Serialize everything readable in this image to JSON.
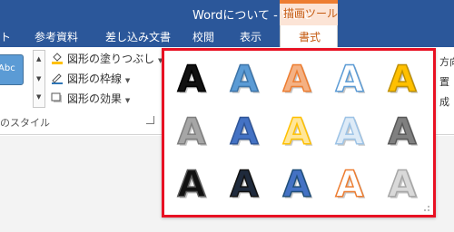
{
  "window": {
    "title": "Wordについて - Word",
    "contextual_tab_group": "描画ツール"
  },
  "tabs": [
    {
      "label": "ト"
    },
    {
      "label": "参考資料"
    },
    {
      "label": "差し込み文書"
    },
    {
      "label": "校閲"
    },
    {
      "label": "表示"
    },
    {
      "label": "書式",
      "active": true
    }
  ],
  "ribbon": {
    "shape_style_thumb": "Abc",
    "commands": {
      "fill": "図形の塗りつぶし",
      "outline": "図形の枠線",
      "effects": "図形の効果"
    },
    "group_label": "のスタイル",
    "right_partial": [
      "方向",
      "置",
      "成"
    ]
  },
  "wordart_gallery": {
    "letter": "A",
    "rows": [
      [
        {
          "style": "fill-black-shadow",
          "fill": "#111111",
          "stroke": "#000000"
        },
        {
          "style": "fill-blue-accent1-shadow",
          "fill": "#5b9bd5",
          "stroke": "#3d74a8"
        },
        {
          "style": "fill-orange-outline",
          "fill": "#f4b183",
          "stroke": "#ed7d31"
        },
        {
          "style": "outline-blue-white-fill",
          "fill": "#ffffff",
          "stroke": "#5b9bd5"
        },
        {
          "style": "fill-gold-gradient",
          "fill": "#ffc000",
          "stroke": "#bf9000"
        }
      ],
      [
        {
          "style": "fill-gray-50",
          "fill": "#a6a6a6",
          "stroke": "#7f7f7f"
        },
        {
          "style": "fill-blue-reflection",
          "fill": "#4472c4",
          "stroke": "#2f5597"
        },
        {
          "style": "fill-yellow-glow",
          "fill": "#ffe699",
          "stroke": "#ffc000"
        },
        {
          "style": "fill-light-blue-outline",
          "fill": "#deebf7",
          "stroke": "#9dc3e6"
        },
        {
          "style": "fill-gray-bevel",
          "fill": "#808080",
          "stroke": "#595959"
        }
      ],
      [
        {
          "style": "fill-black-white-outline",
          "fill": "#111111",
          "stroke": "#595959"
        },
        {
          "style": "fill-dark-blue-shadow",
          "fill": "#1f2a3c",
          "stroke": "#111111"
        },
        {
          "style": "fill-blue-bevel",
          "fill": "#4472c4",
          "stroke": "#1f4e79"
        },
        {
          "style": "outline-orange-white-fill",
          "fill": "#ffffff",
          "stroke": "#ed7d31"
        },
        {
          "style": "fill-silver-gradient",
          "fill": "#d9d9d9",
          "stroke": "#a6a6a6"
        }
      ]
    ]
  }
}
